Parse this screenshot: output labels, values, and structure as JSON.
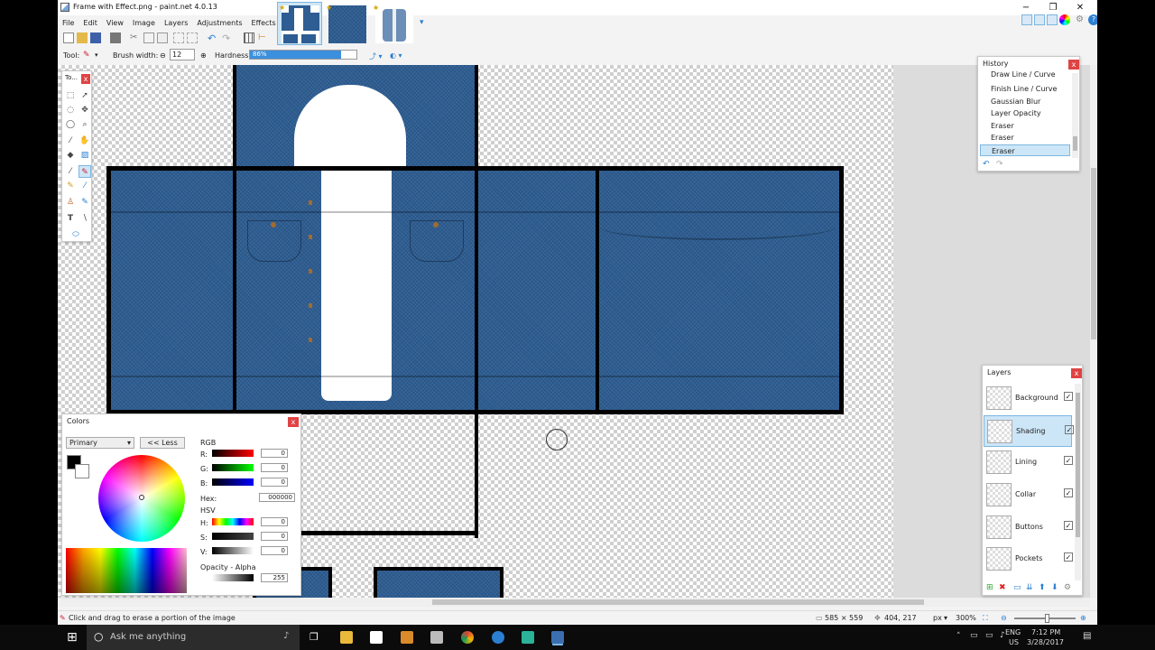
{
  "window": {
    "title": "Frame with Effect.png - paint.net 4.0.13",
    "minimize": "−",
    "restore": "❐",
    "close": "✕"
  },
  "menu": [
    "File",
    "Edit",
    "View",
    "Image",
    "Layers",
    "Adjustments",
    "Effects"
  ],
  "toolbar": {
    "tool_label": "Tool:",
    "brush_width_label": "Brush width:",
    "brush_width_value": "12",
    "hardness_label": "Hardness:",
    "hardness_value": "86%",
    "hardness_fraction": 0.86
  },
  "toolbox": {
    "title": "To...",
    "close": "x"
  },
  "history": {
    "title": "History",
    "close": "x",
    "items": [
      "Draw Line / Curve",
      "Finish Line / Curve",
      "Gaussian Blur",
      "Layer Opacity",
      "Eraser",
      "Eraser",
      "Eraser"
    ]
  },
  "layers": {
    "title": "Layers",
    "close": "x",
    "items": [
      {
        "name": "Background",
        "checked": "✓"
      },
      {
        "name": "Shading",
        "checked": "✓"
      },
      {
        "name": "Lining",
        "checked": "✓"
      },
      {
        "name": "Collar",
        "checked": "✓"
      },
      {
        "name": "Buttons",
        "checked": "✓"
      },
      {
        "name": "Pockets",
        "checked": "✓"
      }
    ]
  },
  "colors": {
    "title": "Colors",
    "close": "x",
    "mode": "Primary",
    "less_button": "<< Less",
    "rgb_label": "RGB",
    "r_label": "R:",
    "g_label": "G:",
    "b_label": "B:",
    "r": "0",
    "g": "0",
    "b": "0",
    "hex_label": "Hex:",
    "hex": "000000",
    "hsv_label": "HSV",
    "h_label": "H:",
    "s_label": "S:",
    "v_label": "V:",
    "h": "0",
    "s": "0",
    "v": "0",
    "opacity_label": "Opacity - Alpha",
    "alpha": "255"
  },
  "status": {
    "hint": "Click and drag to erase a portion of the image",
    "size": "585 × 559",
    "cursor": "404, 217",
    "unit": "px",
    "zoom": "300%"
  },
  "taskbar": {
    "search_placeholder": "Ask me anything",
    "lang": "ENG",
    "region": "US",
    "time": "7:12 PM",
    "date": "3/28/2017"
  },
  "accent_color": "#3b8fdd",
  "denim_color": "#2d5d92"
}
